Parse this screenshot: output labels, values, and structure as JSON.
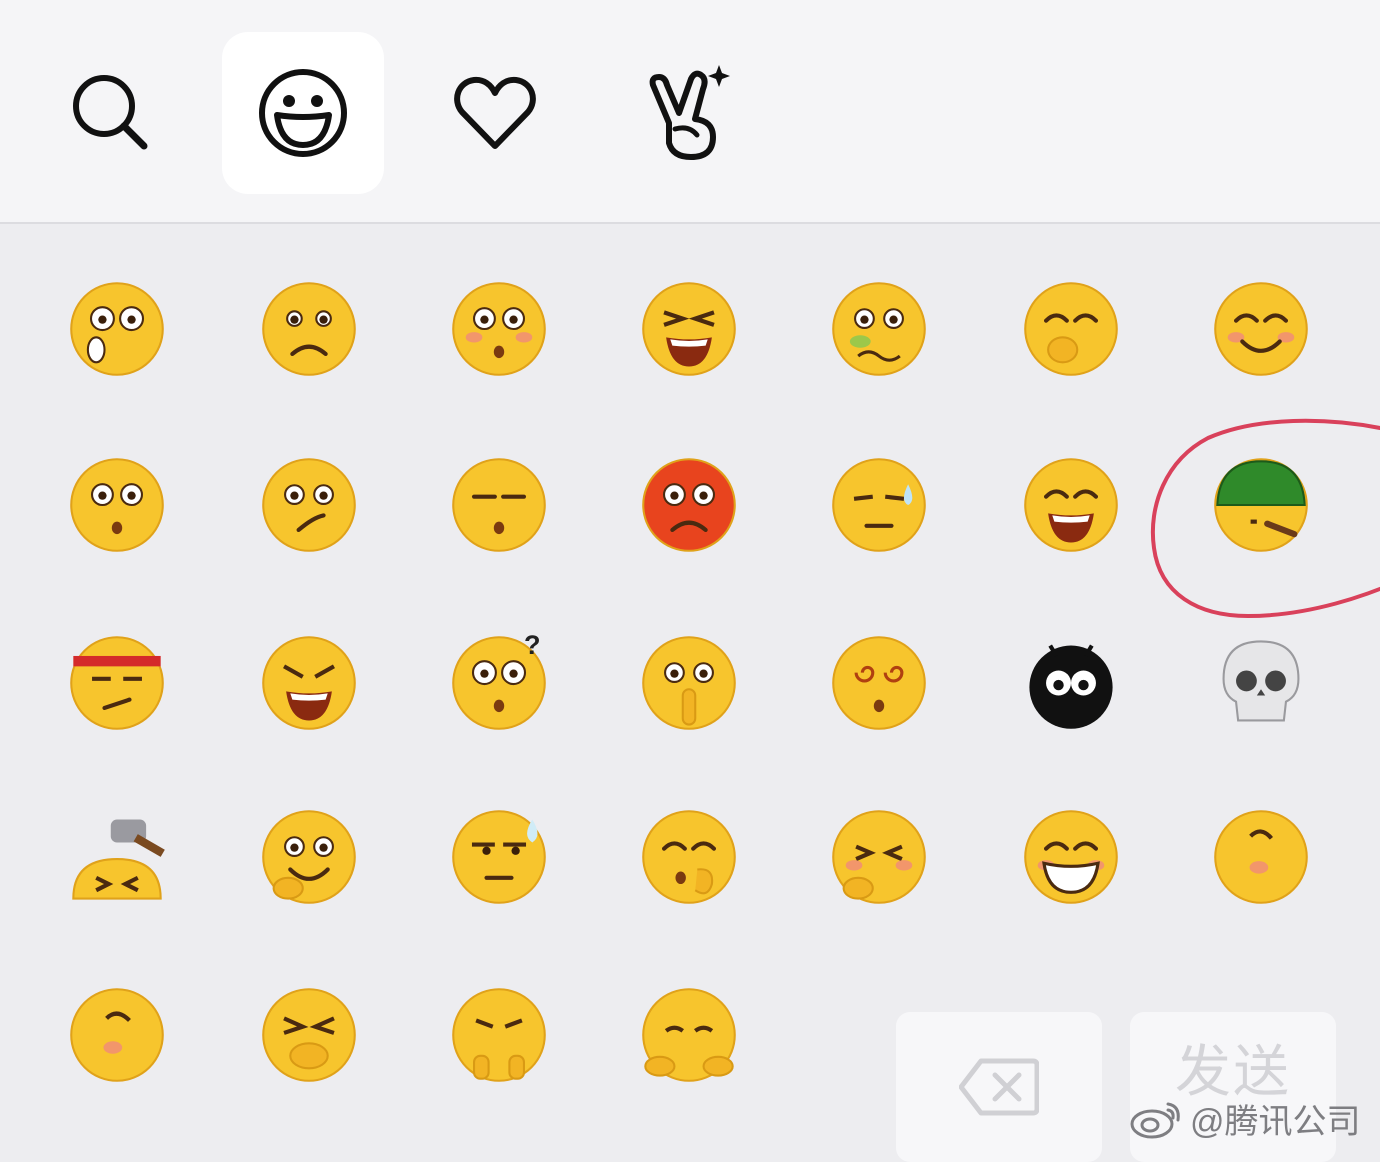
{
  "tabs": [
    {
      "icon": "search-icon"
    },
    {
      "icon": "smiley-icon",
      "active": true
    },
    {
      "icon": "heart-icon"
    },
    {
      "icon": "hand-gesture-icon"
    }
  ],
  "emoji_grid": {
    "rows": [
      [
        "shocked-face-icon",
        "sad-face-icon",
        "eyes-up-face-icon",
        "crying-loud-face-icon",
        "nauseated-face-icon",
        "giggle-face-icon",
        "smile-face-icon"
      ],
      [
        "surprised-face-icon",
        "confused-face-icon",
        "sleepy-face-icon",
        "angry-face-icon",
        "awkward-sweat-face-icon",
        "grin-face-icon",
        "green-helmet-face-icon"
      ],
      [
        "headband-face-icon",
        "snarl-face-icon",
        "question-face-icon",
        "shush-face-icon",
        "dizzy-face-icon",
        "black-blob-face-icon",
        "skull-icon"
      ],
      [
        "hammer-head-icon",
        "pondering-face-icon",
        "sweat-side-eye-face-icon",
        "kiss-face-icon",
        "blush-squint-face-icon",
        "big-grin-face-icon",
        "tilted-smile-face-icon"
      ],
      [
        "sleepy-tilt-face-icon",
        "cover-mouth-face-icon",
        "thumbs-down-face-icon",
        "worried-hug-face-icon"
      ]
    ],
    "highlighted": "green-helmet-face-icon",
    "highlight_color": "#d9415b"
  },
  "keys": {
    "backspace_icon": "backspace-icon",
    "send_label": "发送"
  },
  "watermark": {
    "icon": "weibo-icon",
    "text": "@腾讯公司"
  },
  "colors": {
    "emoji_yellow": "#f7c52d",
    "background": "#ededf0"
  }
}
